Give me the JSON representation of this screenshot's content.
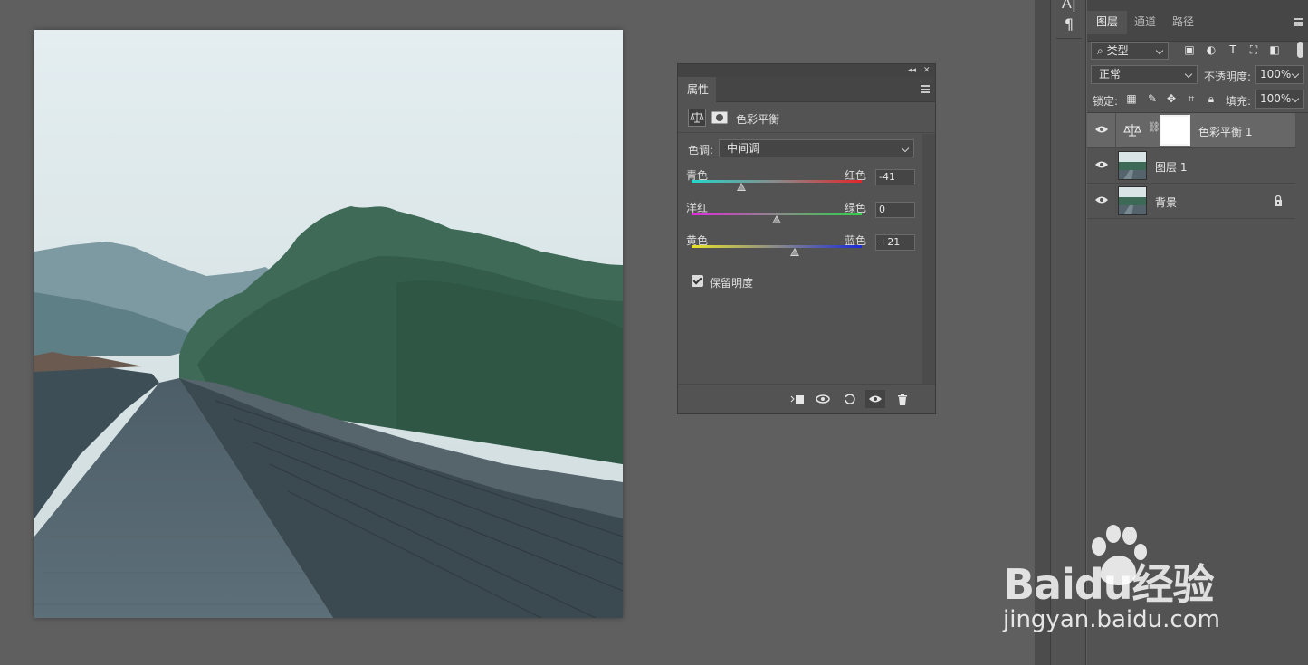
{
  "canvas": {
    "image_desc": "photo"
  },
  "properties_panel": {
    "tab_label": "属性",
    "adjustment_title": "色彩平衡",
    "tone_label": "色调:",
    "tone_value": "中间调",
    "sliders": [
      {
        "left_label": "青色",
        "right_label": "红色",
        "value": "-41",
        "level": -41,
        "colors": [
          "#25d6c9",
          "#e0262b"
        ]
      },
      {
        "left_label": "洋红",
        "right_label": "绿色",
        "value": "0",
        "level": 0,
        "colors": [
          "#e12ad8",
          "#2fd24a"
        ]
      },
      {
        "left_label": "黄色",
        "right_label": "蓝色",
        "value": "+21",
        "level": 21,
        "colors": [
          "#e8e22a",
          "#1b2bd6"
        ]
      }
    ],
    "preserve_luminosity_label": "保留明度",
    "preserve_luminosity_checked": true
  },
  "layers_panel": {
    "tabs": [
      {
        "label": "图层",
        "selected": true
      },
      {
        "label": "通道",
        "selected": false
      },
      {
        "label": "路径",
        "selected": false
      }
    ],
    "filter_label": "类型",
    "blend_mode": "正常",
    "opacity_label": "不透明度:",
    "opacity_value": "100%",
    "lock_label": "锁定:",
    "fill_label": "填充:",
    "fill_value": "100%",
    "layers": [
      {
        "name": "色彩平衡 1",
        "type": "adjustment",
        "selected": true
      },
      {
        "name": "图层 1",
        "type": "image",
        "selected": false
      },
      {
        "name": "背景",
        "type": "image",
        "locked": true,
        "selected": false
      }
    ]
  },
  "watermark": {
    "brand": "Baidu经验",
    "url": "jingyan.baidu.com"
  },
  "colors": {
    "workspace": "#5f5f5f",
    "panel": "#535353",
    "accent_white": "#ffffff"
  }
}
